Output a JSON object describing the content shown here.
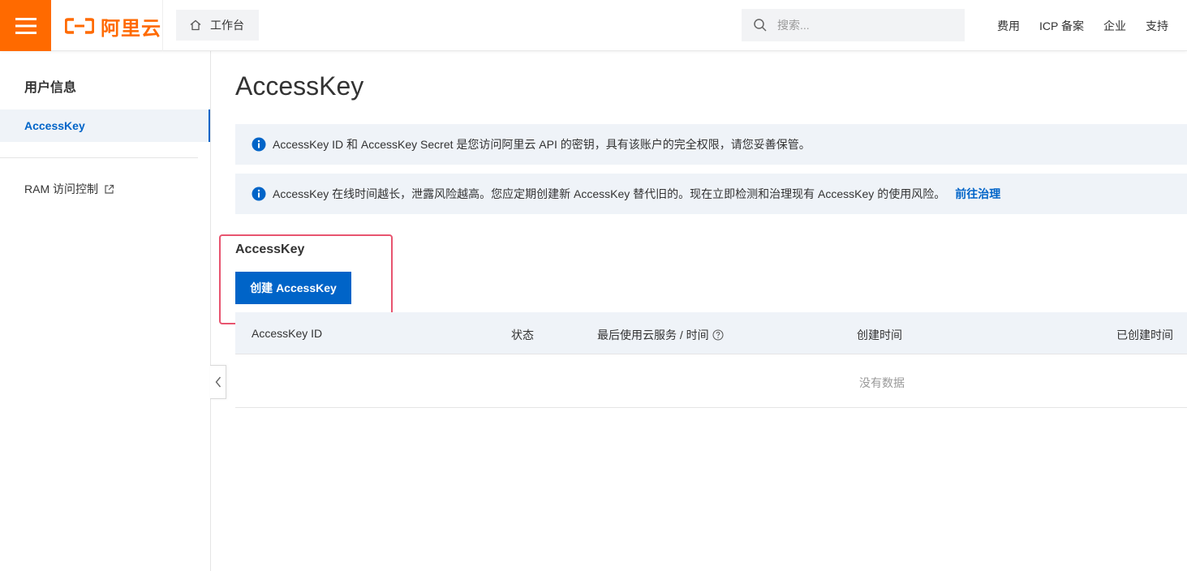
{
  "header": {
    "logo_text": "阿里云",
    "workbench_label": "工作台",
    "search_placeholder": "搜索...",
    "links": [
      "费用",
      "ICP 备案",
      "企业",
      "支持"
    ]
  },
  "sidebar": {
    "title": "用户信息",
    "active_item": "AccessKey",
    "ram_item": "RAM 访问控制"
  },
  "main": {
    "page_title": "AccessKey",
    "notice1": "AccessKey ID 和 AccessKey Secret 是您访问阿里云 API 的密钥，具有该账户的完全权限，请您妥善保管。",
    "notice2": "AccessKey 在线时间越长，泄露风险越高。您应定期创建新 AccessKey 替代旧的。现在立即检测和治理现有 AccessKey 的使用风险。",
    "notice2_link": "前往治理",
    "section_title": "AccessKey",
    "create_button": "创建 AccessKey",
    "table": {
      "columns": [
        "AccessKey ID",
        "状态",
        "最后使用云服务 / 时间",
        "创建时间",
        "已创建时间"
      ],
      "empty_text": "没有数据"
    }
  },
  "colors": {
    "brand_orange": "#ff6a00",
    "primary_blue": "#0064c8",
    "highlight_red": "#e8546f",
    "notice_bg": "#eff3f8"
  }
}
